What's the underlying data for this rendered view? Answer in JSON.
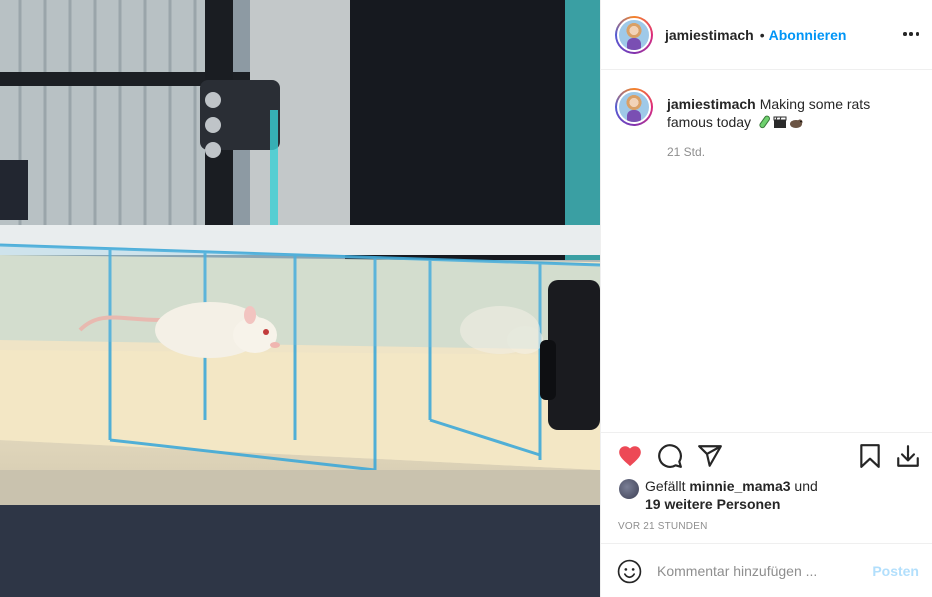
{
  "header": {
    "username": "jamiestimach",
    "separator": "•",
    "follow_label": "Abonnieren",
    "more_icon": "more-horizontal-icon"
  },
  "caption": {
    "username": "jamiestimach",
    "text": "Making some rats famous today",
    "emojis": [
      "test-tube-icon",
      "clapper-board-icon",
      "rat-icon"
    ],
    "time": "21 Std."
  },
  "actions": {
    "like_icon": "heart-filled-icon",
    "like_color": "#ed4956",
    "comment_icon": "comment-icon",
    "share_icon": "paper-plane-icon",
    "save_icon": "bookmark-icon",
    "download_icon": "download-icon"
  },
  "likes": {
    "prefix": "Gefällt",
    "user": "minnie_mama3",
    "conjunction": "und",
    "others": "19 weitere Personen"
  },
  "posted_ago": "VOR 21 STUNDEN",
  "comment": {
    "placeholder": "Kommentar hinzufügen ...",
    "post_label": "Posten",
    "emoji_icon": "smiley-icon"
  },
  "colors": {
    "accent": "#0095f6",
    "post_disabled": "#b2dffc",
    "muted": "#8e8e8e"
  }
}
